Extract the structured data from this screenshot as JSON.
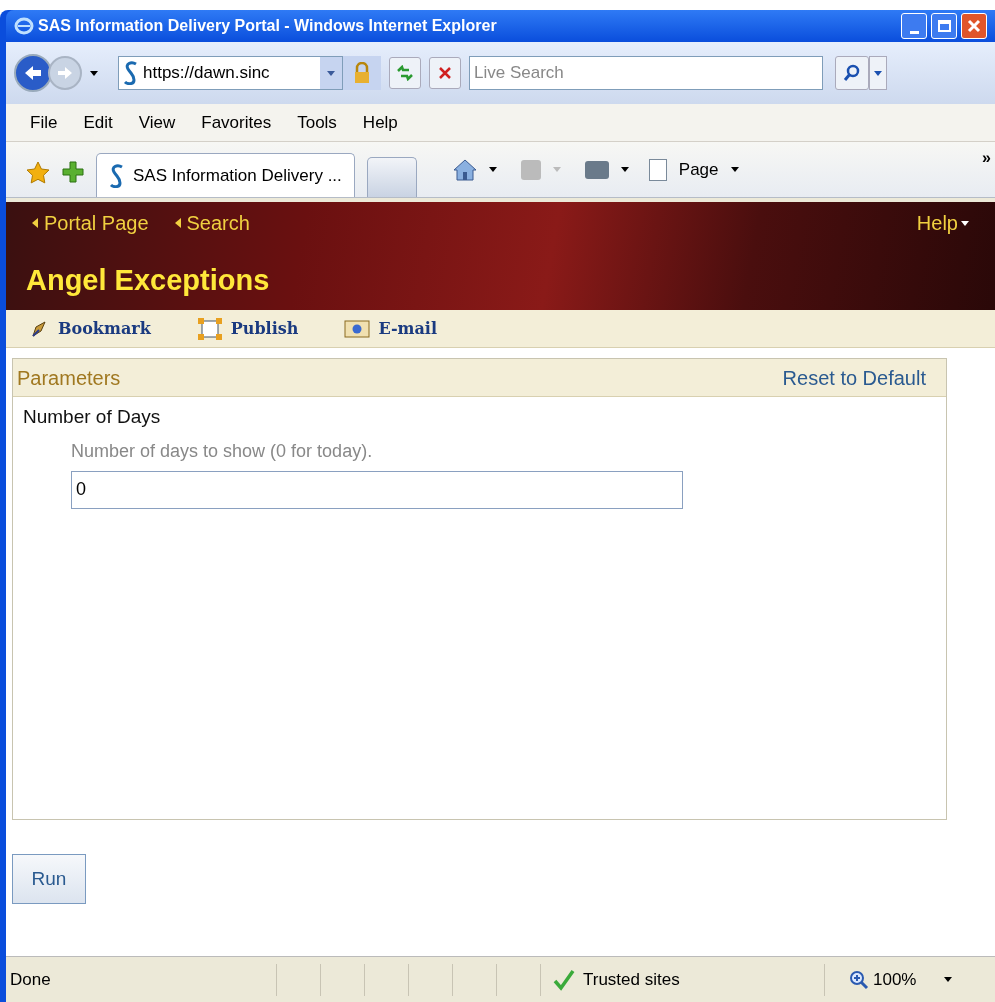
{
  "window": {
    "title": "SAS Information Delivery Portal - Windows Internet Explorer"
  },
  "nav": {
    "address": "https://dawn.sinc",
    "search_placeholder": "Live Search"
  },
  "menu": [
    "File",
    "Edit",
    "View",
    "Favorites",
    "Tools",
    "Help"
  ],
  "tabs": [
    {
      "label": "SAS Information Delivery ...",
      "selected": true
    }
  ],
  "command_bar": {
    "page": "Page",
    "more": "»"
  },
  "portal": {
    "links": [
      "Portal Page",
      "Search"
    ],
    "help": "Help",
    "title": "Angel Exceptions",
    "actions": [
      {
        "kind": "bookmark",
        "label": "Bookmark"
      },
      {
        "kind": "publish",
        "label": "Publish"
      },
      {
        "kind": "email",
        "label": "E-mail"
      }
    ]
  },
  "parameters": {
    "header": "Parameters",
    "reset": "Reset to Default",
    "fields": [
      {
        "label": "Number of Days",
        "description": "Number of days to show (0 for today).",
        "value": "0"
      }
    ]
  },
  "run_button": "Run",
  "status_bar": {
    "text": "Done",
    "zone": "Trusted sites",
    "zoom": "100%"
  }
}
